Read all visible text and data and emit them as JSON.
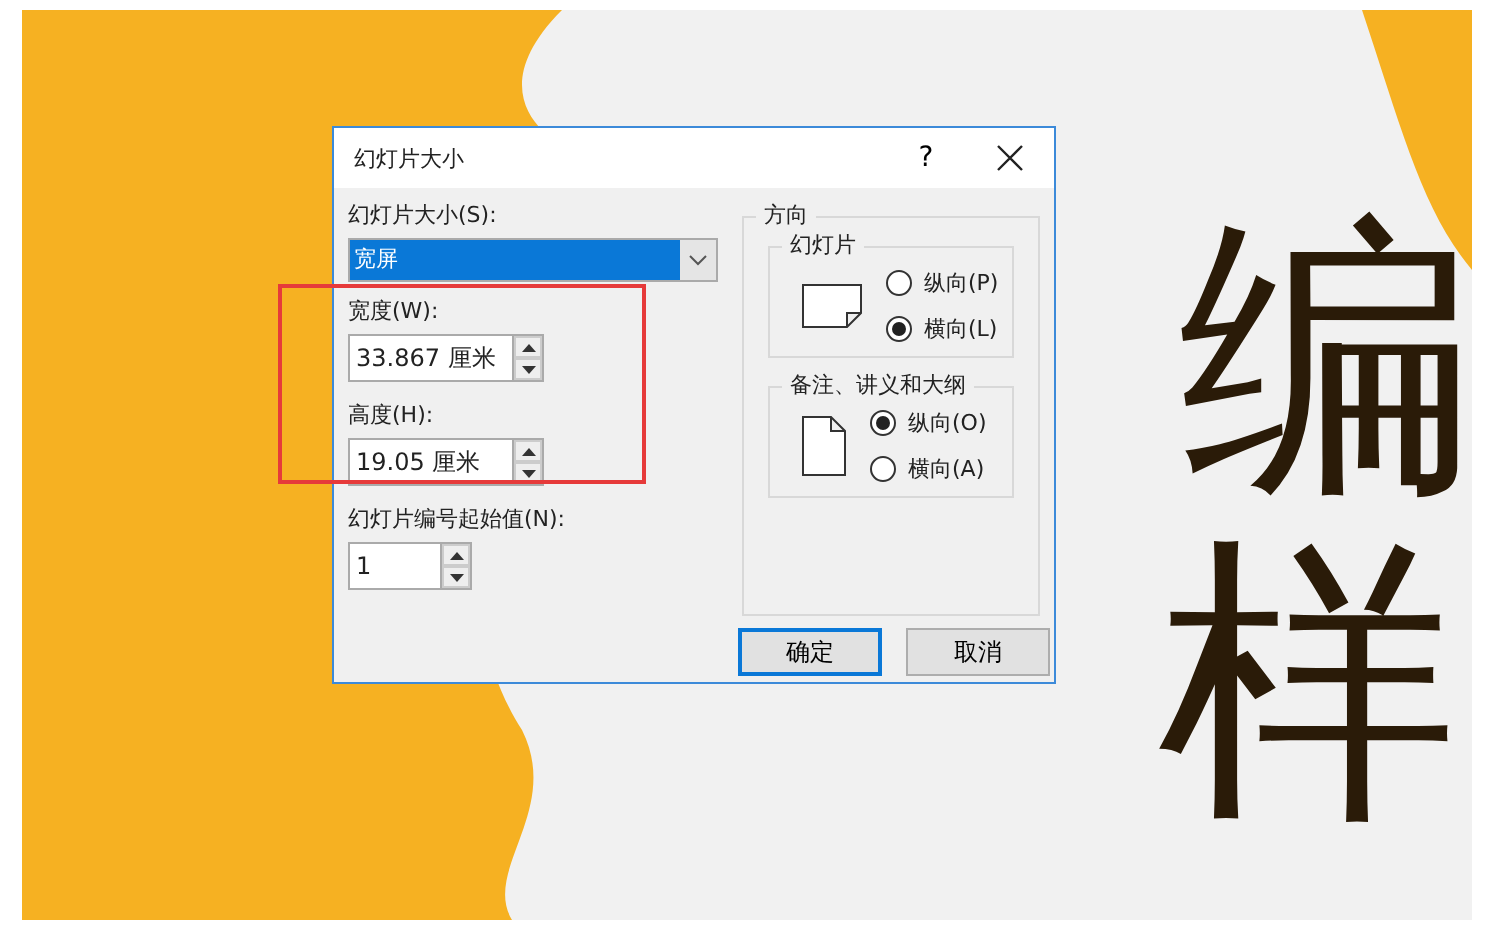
{
  "slide": {
    "title_lines": [
      "编",
      "样"
    ]
  },
  "dialog": {
    "title": "幻灯片大小",
    "help": "?",
    "size": {
      "label": "幻灯片大小(S):",
      "value": "宽屏"
    },
    "width": {
      "label": "宽度(W):",
      "value": "33.867 厘米"
    },
    "height": {
      "label": "高度(H):",
      "value": "19.05 厘米"
    },
    "start_number": {
      "label": "幻灯片编号起始值(N):",
      "value": "1"
    },
    "orientation": {
      "title": "方向",
      "groups": [
        {
          "title": "幻灯片",
          "kind": "landscape",
          "options": [
            {
              "label": "纵向(P)",
              "selected": false
            },
            {
              "label": "横向(L)",
              "selected": true
            }
          ]
        },
        {
          "title": "备注、讲义和大纲",
          "kind": "portrait",
          "options": [
            {
              "label": "纵向(O)",
              "selected": true
            },
            {
              "label": "横向(A)",
              "selected": false
            }
          ]
        }
      ]
    },
    "buttons": [
      {
        "label": "确定",
        "default": true
      },
      {
        "label": "取消",
        "default": false
      }
    ]
  }
}
